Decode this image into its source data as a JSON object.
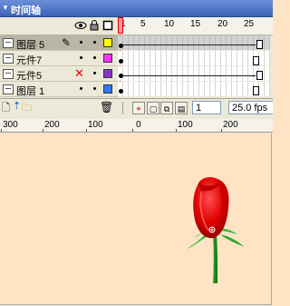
{
  "panel": {
    "title": "时间轴"
  },
  "header_icons": [
    "eye-icon",
    "lock-icon",
    "outline-icon"
  ],
  "ruler": {
    "frames": [
      "1",
      "5",
      "10",
      "15",
      "20",
      "25"
    ]
  },
  "layers": [
    {
      "name": "图层 5",
      "selected": true,
      "color": "#ffff00"
    },
    {
      "name": "元件7",
      "selected": false,
      "color": "#ff33ff"
    },
    {
      "name": "元件5",
      "selected": false,
      "color": "#8833cc"
    },
    {
      "name": "图层 1",
      "selected": false,
      "color": "#3377ff"
    }
  ],
  "toolbar": {
    "current_frame": "1",
    "frame_rate": "25.0 fps"
  },
  "stage_ruler": {
    "ticks": [
      "300",
      "200",
      "100",
      "0",
      "100",
      "200"
    ]
  }
}
